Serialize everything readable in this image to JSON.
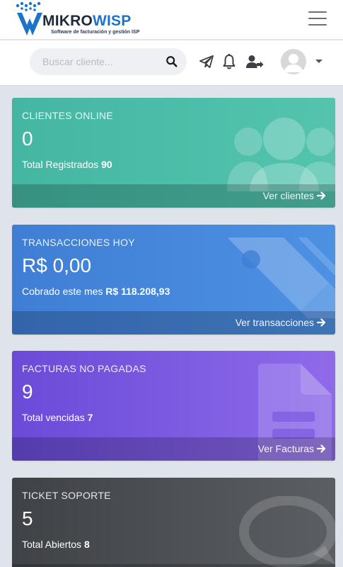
{
  "brand": {
    "word_dark": "MIKRO",
    "word_blue": "WISP",
    "tagline": "Software de facturación y gestión ISP",
    "colors": {
      "dark": "#1f2a3a",
      "blue": "#1b74c8"
    }
  },
  "topbar": {
    "menu_icon": "hamburger-menu-icon"
  },
  "toolbar": {
    "search_placeholder": "Buscar cliente...",
    "icons": [
      "search-icon",
      "send-icon",
      "bell-icon",
      "user-share-icon",
      "avatar",
      "chevron-down-icon"
    ]
  },
  "cards": [
    {
      "label": "CLIENTES ONLINE",
      "value": "0",
      "sub_text": "Total Registrados",
      "sub_value": "90",
      "link": "Ver clientes",
      "icon": "users-icon",
      "color": "#4bbda8"
    },
    {
      "label": "TRANSACCIONES HOY",
      "value": "R$ 0,00",
      "sub_text": "Cobrado este mes",
      "sub_value": "R$ 118.208,93",
      "link": "Ver transacciones",
      "icon": "tag-icon",
      "color": "#4688dc"
    },
    {
      "label": "FACTURAS NO PAGADAS",
      "value": "9",
      "sub_text": "Total vencidas",
      "sub_value": "7",
      "link": "Ver Facturas",
      "icon": "file-invoice-icon",
      "color": "#7b5ae0"
    },
    {
      "label": "TICKET SOPORTE",
      "value": "5",
      "sub_text": "Total Abiertos",
      "sub_value": "8",
      "link": "",
      "icon": "chat-bubble-icon",
      "color": "#4b4e52"
    }
  ]
}
